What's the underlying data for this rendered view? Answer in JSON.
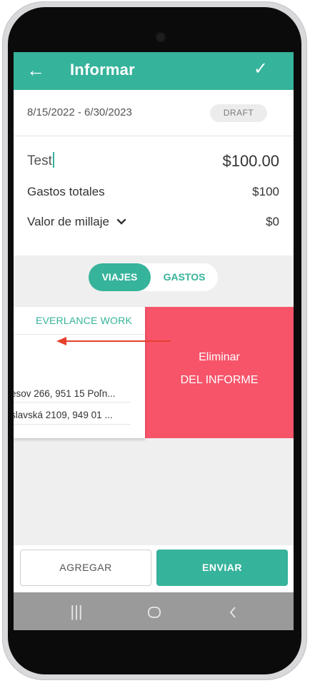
{
  "appbar": {
    "title": "Informar",
    "back_icon": "←",
    "confirm_icon": "✓"
  },
  "report": {
    "date_range": "8/15/2022 - 6/30/2023",
    "status": "DRAFT",
    "name": "Test",
    "total_amount": "$100.00",
    "expenses_label": "Gastos totales",
    "expenses_value": "$100",
    "mileage_label": "Valor de millaje",
    "mileage_value": "$0"
  },
  "tabs": {
    "trips": "VIAJES",
    "expenses": "GASTOS",
    "active": "VIAJES"
  },
  "card": {
    "header": "EVERLANCE WORK",
    "addresses": [
      "esov 266, 951 15 Poľn...",
      "slavská 2109, 949 01 ..."
    ]
  },
  "delete_action": {
    "line1": "Eliminar",
    "line2": "DEL INFORME",
    "color": "#f7546a"
  },
  "actions": {
    "add": "AGREGAR",
    "send": "ENVIAR"
  },
  "navbar": {
    "recents": "|||",
    "home": "○",
    "back": "‹"
  },
  "colors": {
    "accent": "#36b39b",
    "delete": "#f7546a",
    "arrow": "#e5412e"
  }
}
